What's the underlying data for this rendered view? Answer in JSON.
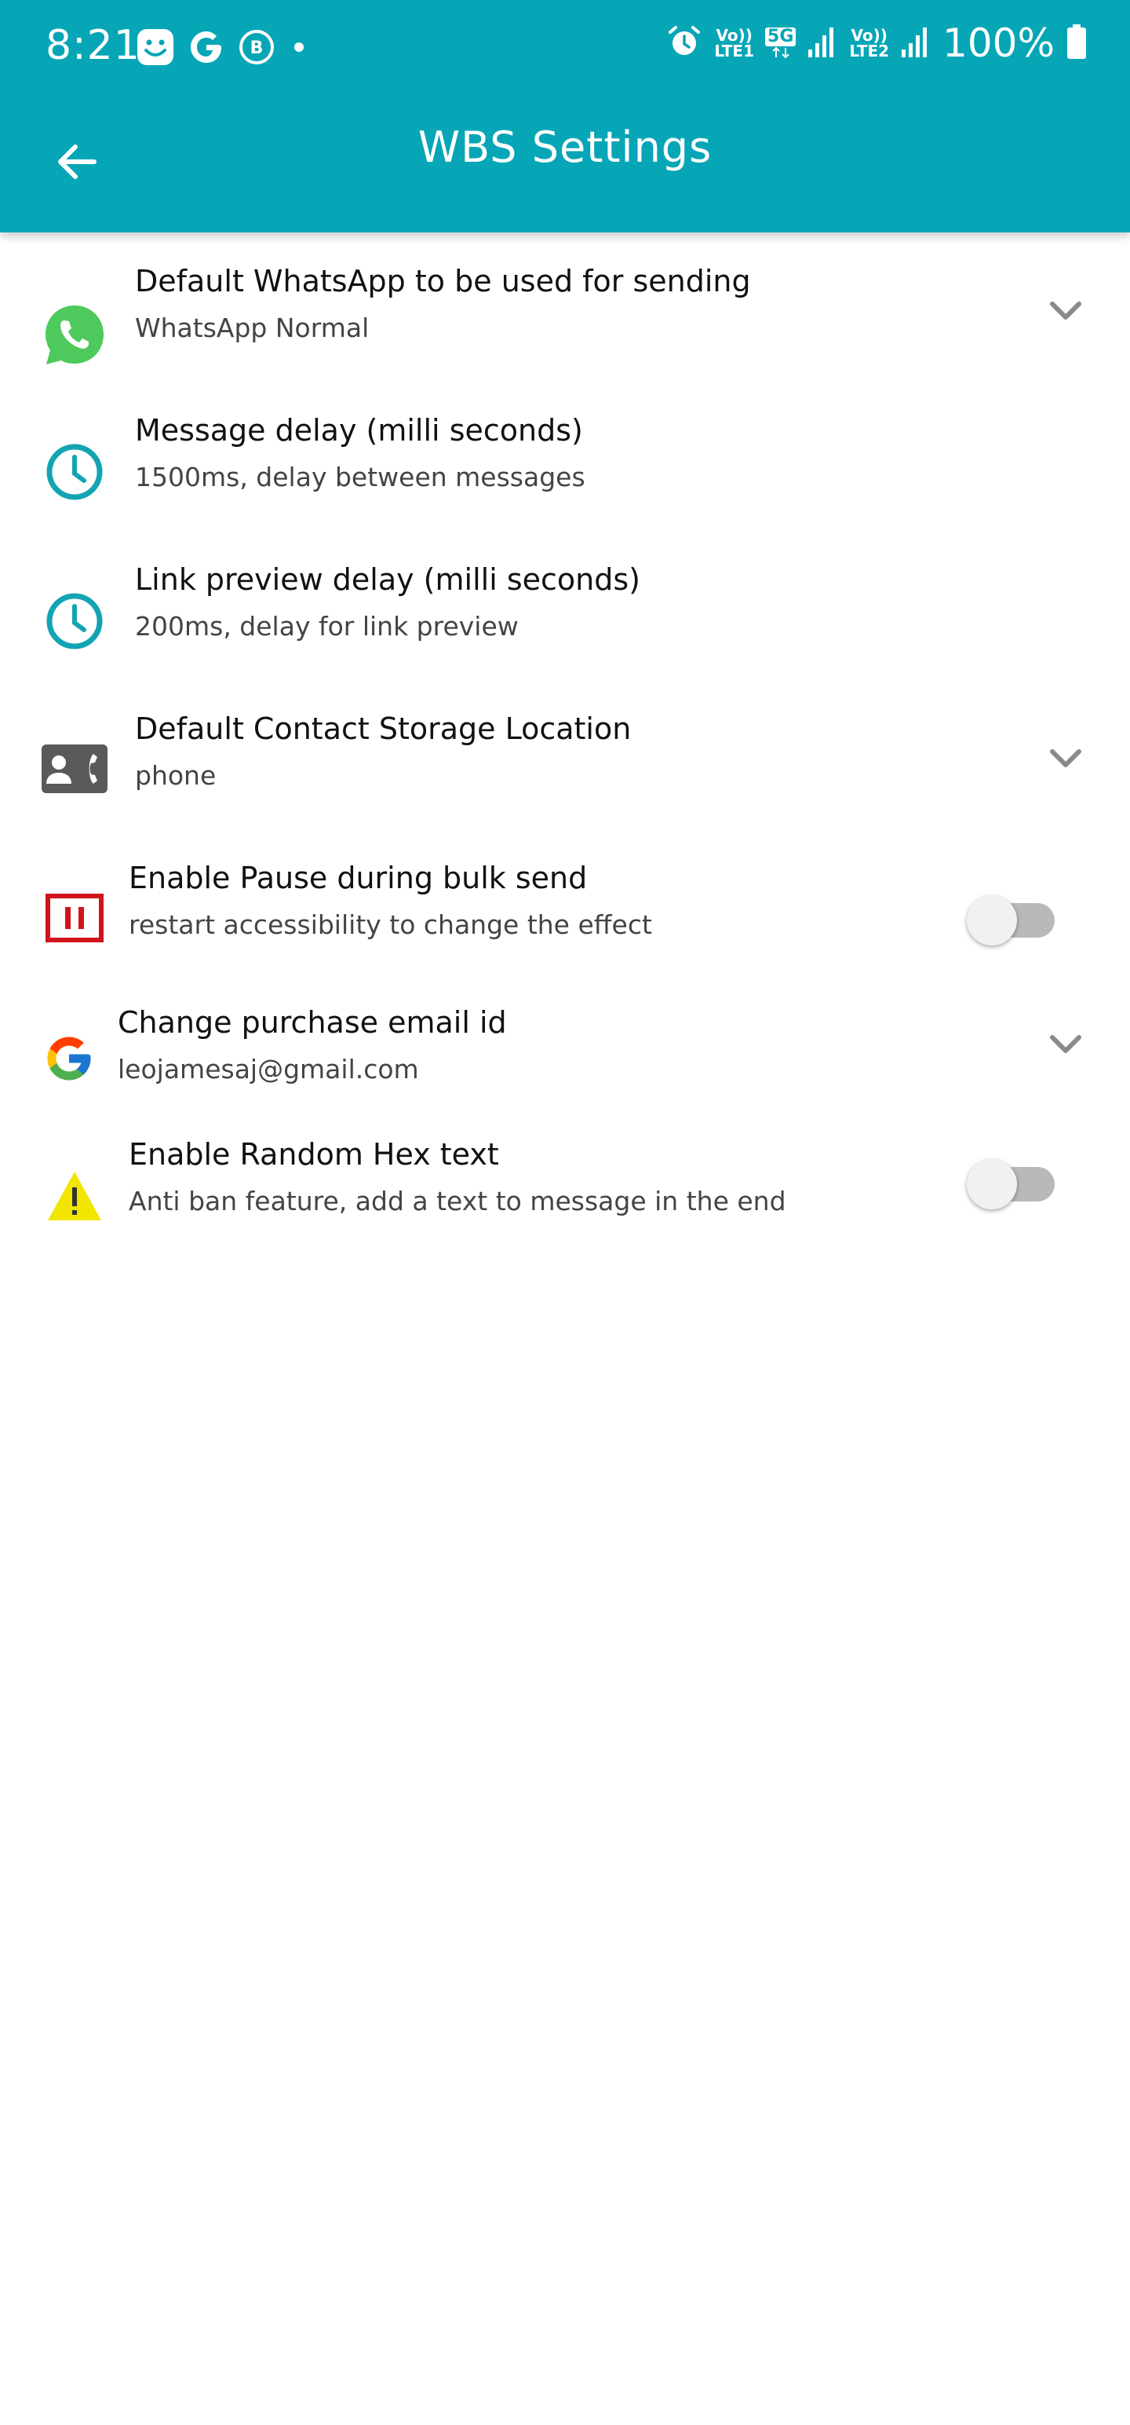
{
  "status_bar": {
    "time": "8:21",
    "battery_percent": "100%",
    "sim1_label": "Vo)) LTE1",
    "sim2_label": "Vo)) LTE2",
    "network_badge": "5G"
  },
  "toolbar": {
    "title": "WBS Settings"
  },
  "settings": [
    {
      "title": "Default WhatsApp to be used for sending",
      "subtitle": "WhatsApp Normal",
      "icon": "whatsapp-icon",
      "control": "dropdown"
    },
    {
      "title": "Message delay (milli seconds)",
      "subtitle": "1500ms, delay between messages",
      "icon": "clock-icon",
      "control": "none"
    },
    {
      "title": "Link preview delay (milli seconds)",
      "subtitle": "200ms, delay for link preview",
      "icon": "clock-icon",
      "control": "none"
    },
    {
      "title": "Default Contact Storage Location",
      "subtitle": "phone",
      "icon": "contact-phone-icon",
      "control": "dropdown"
    },
    {
      "title": "Enable Pause during bulk send",
      "subtitle": "restart accessibility to change the effect",
      "icon": "pause-icon",
      "control": "toggle",
      "enabled": false
    },
    {
      "title": "Change purchase email id",
      "subtitle": "leojamesaj@gmail.com",
      "icon": "google-icon",
      "control": "dropdown"
    },
    {
      "title": "Enable Random Hex text",
      "subtitle": "Anti ban feature, add a text to message in the end",
      "icon": "warning-icon",
      "control": "toggle",
      "enabled": false
    }
  ],
  "colors": {
    "primary": "#06a6b6",
    "whatsapp_green": "#4ec95b",
    "clock_teal": "#13a4b4",
    "pause_red": "#d0141c",
    "warning_yellow": "#f2e600",
    "chevron_gray": "#8a8a8a"
  }
}
